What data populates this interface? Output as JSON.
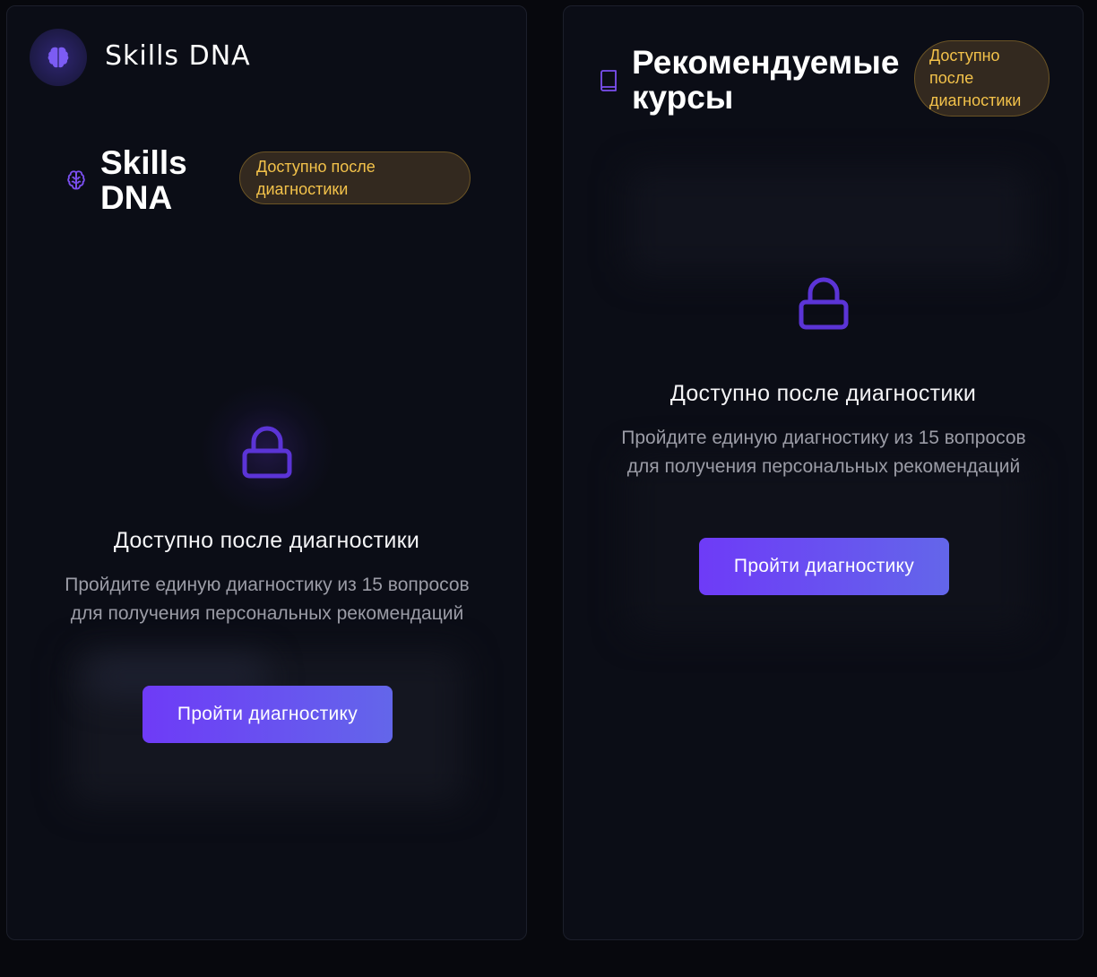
{
  "brand": {
    "name": "Skills DNA",
    "logo_icon": "brain-icon"
  },
  "skills_card": {
    "icon": "brain-outline-icon",
    "title": "Skills DNA",
    "badge": "Доступно после диагностики",
    "lock_icon": "lock-icon",
    "locked_title": "Доступно после диагностики",
    "locked_description": "Пройдите единую диагностику из 15 вопросов для получения персональных рекомендаций",
    "cta_label": "Пройти диагностику"
  },
  "courses_card": {
    "icon": "book-icon",
    "title": "Рекомендуемые курсы",
    "badge": "Доступно после диагностики",
    "lock_icon": "lock-icon",
    "locked_title": "Доступно после диагностики",
    "locked_description": "Пройдите единую диагностику из 15 вопросов для получения персональных рекомендаций",
    "cta_label": "Пройти диагностику"
  },
  "colors": {
    "background": "#07080d",
    "card": "#0b0d16",
    "accent": "#6e3bf7",
    "badge_text": "#f3c24a",
    "lock": "#5b34d6"
  }
}
